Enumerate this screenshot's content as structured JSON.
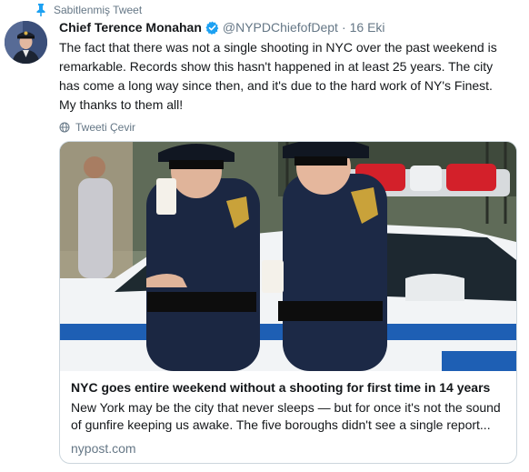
{
  "pinned": {
    "label": "Sabitlenmiş Tweet",
    "icon": "pin-icon"
  },
  "tweet": {
    "author_name": "Chief Terence Monahan",
    "verified_icon": "verified-badge-icon",
    "handle": "@NYPDChiefofDept",
    "separator": "·",
    "date": "16 Eki",
    "text": "The fact that there was not a single shooting in NYC over the past weekend is remarkable. Records show this hasn't happened in at least 25 years. The city has come a long way since then, and it's due to the hard work of NY's Finest. My thanks to them all!",
    "translate_label": "Tweeti Çevir"
  },
  "card": {
    "image_alt": "Two NYPD officers drinking coffee beside a patrol car",
    "title": "NYC goes entire weekend without a shooting for first time in 14 years",
    "description": "New York may be the city that never sleeps — but for once it's not the sound of gunfire keeping us awake. The five boroughs didn't see a single report...",
    "domain": "nypost.com"
  },
  "colors": {
    "accent": "#1da1f2",
    "secondary_text": "#657786",
    "border": "#ccd6dd"
  }
}
